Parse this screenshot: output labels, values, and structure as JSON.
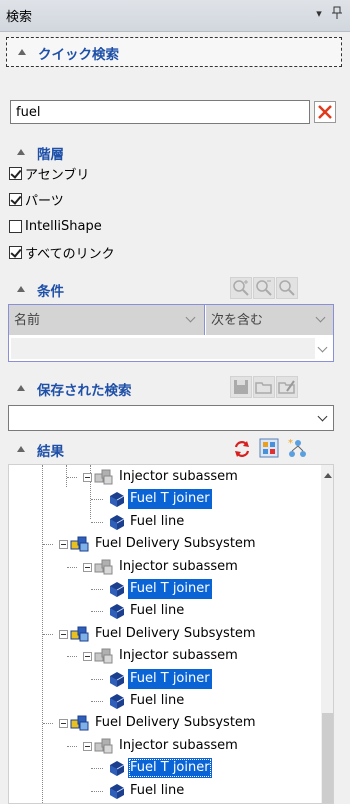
{
  "titlebar": {
    "title": "検索",
    "dropdown_icon": "chevron-down-icon",
    "pin_icon": "pin-icon"
  },
  "quick_search": {
    "title": "クイック検索"
  },
  "search": {
    "value": "fuel",
    "clear_icon": "close-icon"
  },
  "hierarchy": {
    "title": "階層",
    "options": [
      {
        "label": "アセンブリ",
        "checked": true
      },
      {
        "label": "パーツ",
        "checked": true
      },
      {
        "label": "IntelliShape",
        "checked": false
      },
      {
        "label": "すべてのリンク",
        "checked": true
      }
    ]
  },
  "conditions": {
    "title": "条件",
    "field_label": "名前",
    "operator_label": "次を含む",
    "tool_icons": [
      "zoom-in-icon",
      "zoom-in-alt-icon",
      "zoom-icon"
    ]
  },
  "saved": {
    "title": "保存された検索",
    "tool_icons": [
      "save-icon",
      "open-folder-icon",
      "edit-icon"
    ]
  },
  "results": {
    "title": "結果",
    "tool_icons": [
      "refresh-icon",
      "select-all-icon",
      "new-node-icon"
    ],
    "items": [
      {
        "label": "Injector subassem",
        "type": "assembly",
        "depth": 1
      },
      {
        "label": "Fuel T joiner",
        "type": "part",
        "depth": 2,
        "selected": true
      },
      {
        "label": "Fuel line",
        "type": "part",
        "depth": 2
      },
      {
        "label": "Fuel Delivery Subsystem",
        "type": "assembly-colored",
        "depth": 0
      },
      {
        "label": "Injector subassem",
        "type": "assembly",
        "depth": 1
      },
      {
        "label": "Fuel T joiner",
        "type": "part",
        "depth": 2,
        "selected": true
      },
      {
        "label": "Fuel line",
        "type": "part",
        "depth": 2
      },
      {
        "label": "Fuel Delivery Subsystem",
        "type": "assembly-colored",
        "depth": 0
      },
      {
        "label": "Injector subassem",
        "type": "assembly",
        "depth": 1
      },
      {
        "label": "Fuel T joiner",
        "type": "part",
        "depth": 2,
        "selected": true
      },
      {
        "label": "Fuel line",
        "type": "part",
        "depth": 2
      },
      {
        "label": "Fuel Delivery Subsystem",
        "type": "assembly-colored",
        "depth": 0
      },
      {
        "label": "Injector subassem",
        "type": "assembly",
        "depth": 1
      },
      {
        "label": "Fuel T joiner",
        "type": "part",
        "depth": 2,
        "selected": true,
        "focused": true
      },
      {
        "label": "Fuel line",
        "type": "part",
        "depth": 2
      }
    ]
  }
}
